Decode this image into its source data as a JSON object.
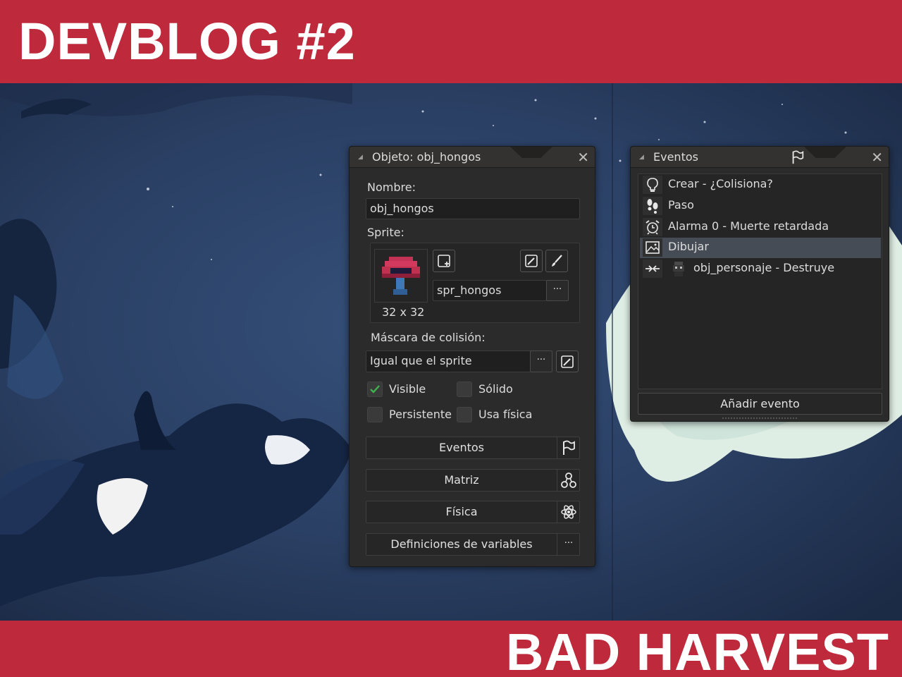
{
  "banner_top": {
    "title": "DEVBLOG #2"
  },
  "banner_bottom": {
    "title": "BAD HARVEST"
  },
  "object_window": {
    "title": "Objeto: obj_hongos",
    "name_label": "Nombre:",
    "name_value": "obj_hongos",
    "sprite_label": "Sprite:",
    "sprite_size": "32 x 32",
    "sprite_name": "spr_hongos",
    "more_glyph": "···",
    "mask_label": "Máscara de colisión:",
    "mask_value": "Igual que el sprite",
    "checkboxes": [
      {
        "label": "Visible",
        "checked": true
      },
      {
        "label": "Sólido",
        "checked": false
      },
      {
        "label": "Persistente",
        "checked": false
      },
      {
        "label": "Usa física",
        "checked": false
      }
    ],
    "buttons": [
      {
        "label": "Eventos",
        "icon": "flag-icon"
      },
      {
        "label": "Matriz",
        "icon": "hierarchy-icon"
      },
      {
        "label": "Física",
        "icon": "atom-icon"
      },
      {
        "label": "Definiciones de variables",
        "icon": "more-icon"
      }
    ]
  },
  "events_window": {
    "title": "Eventos",
    "events": [
      {
        "label": "Crear - ¿Colisiona?",
        "icon": "lightbulb-icon",
        "selected": false
      },
      {
        "label": "Paso",
        "icon": "footsteps-icon",
        "selected": false
      },
      {
        "label": "Alarma 0 - Muerte retardada",
        "icon": "alarm-clock-icon",
        "selected": false
      },
      {
        "label": "Dibujar",
        "icon": "picture-icon",
        "selected": true
      },
      {
        "label": "obj_personaje - Destruye",
        "icon": "collision-icon",
        "selected": false
      }
    ],
    "add_button": "Añadir evento"
  },
  "colors": {
    "banner": "#be2a3c",
    "window_bg": "#2b2b2b",
    "selection": "#464c55",
    "check_green": "#3fb34f"
  }
}
